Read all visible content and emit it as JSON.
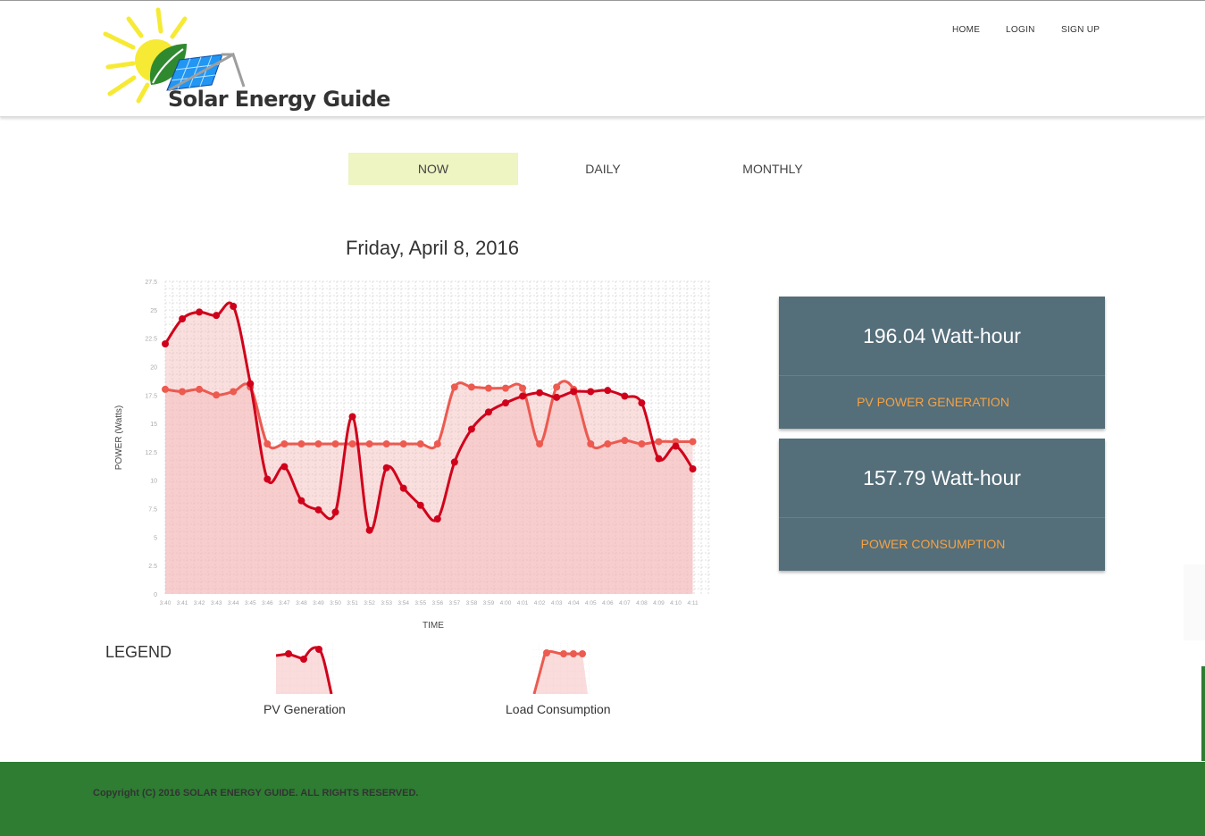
{
  "brand": {
    "name": "Solar Energy Guide"
  },
  "nav": {
    "home": "HOME",
    "login": "LOGIN",
    "signup": "SIGN UP"
  },
  "tabs": {
    "now": "NOW",
    "daily": "DAILY",
    "monthly": "MONTHLY",
    "active": "now"
  },
  "chart_title": "Friday, April 8, 2016",
  "stats": [
    {
      "value": "196.04 Watt-hour",
      "label": "PV POWER GENERATION"
    },
    {
      "value": "157.79 Watt-hour",
      "label": "POWER CONSUMPTION"
    }
  ],
  "legend": {
    "title": "LEGEND",
    "pv": "PV Generation",
    "load": "Load Consumption"
  },
  "footer": {
    "copyright": "Copyright (C) 2016 SOLAR ENERGY GUIDE. ALL RIGHTS RESERVED."
  },
  "colors": {
    "pv": "#d0021b",
    "load": "#ec5a50",
    "fill": "#f5b9b9",
    "panel": "#546e7a",
    "accent": "#f5a244",
    "footer": "#2e7d32",
    "tab_active": "#eef4c2"
  },
  "chart_data": {
    "type": "area",
    "title": "Friday, April 8, 2016",
    "xlabel": "TIME",
    "ylabel": "POWER (Watts)",
    "ylim": [
      0,
      27.5
    ],
    "yticks": [
      "0",
      "2.5",
      "5",
      "7.5",
      "10",
      "12.5",
      "15",
      "17.5",
      "20",
      "22.5",
      "25",
      "27.5"
    ],
    "categories": [
      "3:40",
      "3:41",
      "3:42",
      "3:43",
      "3:44",
      "3:45",
      "3:46",
      "3:47",
      "3:48",
      "3:49",
      "3:50",
      "3:51",
      "3:52",
      "3:53",
      "3:54",
      "3:55",
      "3:56",
      "3:57",
      "3:58",
      "3:59",
      "4:00",
      "4:01",
      "4:02",
      "4:03",
      "4:04",
      "4:05",
      "4:06",
      "4:07",
      "4:08",
      "4:09",
      "4:10",
      "4:11"
    ],
    "grid": true,
    "series": [
      {
        "name": "PV Generation",
        "color": "#d0021b",
        "values": [
          22.0,
          24.2,
          24.8,
          24.5,
          25.3,
          18.5,
          10.1,
          11.2,
          8.2,
          7.4,
          7.2,
          15.6,
          5.6,
          11.1,
          9.3,
          7.8,
          6.6,
          11.6,
          14.5,
          16.0,
          16.8,
          17.4,
          17.7,
          17.3,
          17.8,
          17.8,
          17.9,
          17.4,
          16.8,
          11.9,
          13.0,
          11.0
        ]
      },
      {
        "name": "Load Consumption",
        "color": "#ec5a50",
        "values": [
          18.0,
          17.8,
          18.0,
          17.5,
          17.8,
          18.2,
          13.2,
          13.2,
          13.2,
          13.2,
          13.2,
          13.2,
          13.2,
          13.2,
          13.2,
          13.2,
          13.2,
          18.2,
          18.2,
          18.1,
          18.1,
          18.1,
          13.2,
          18.2,
          18.0,
          13.2,
          13.2,
          13.5,
          13.2,
          13.4,
          13.4,
          13.4
        ]
      }
    ]
  }
}
